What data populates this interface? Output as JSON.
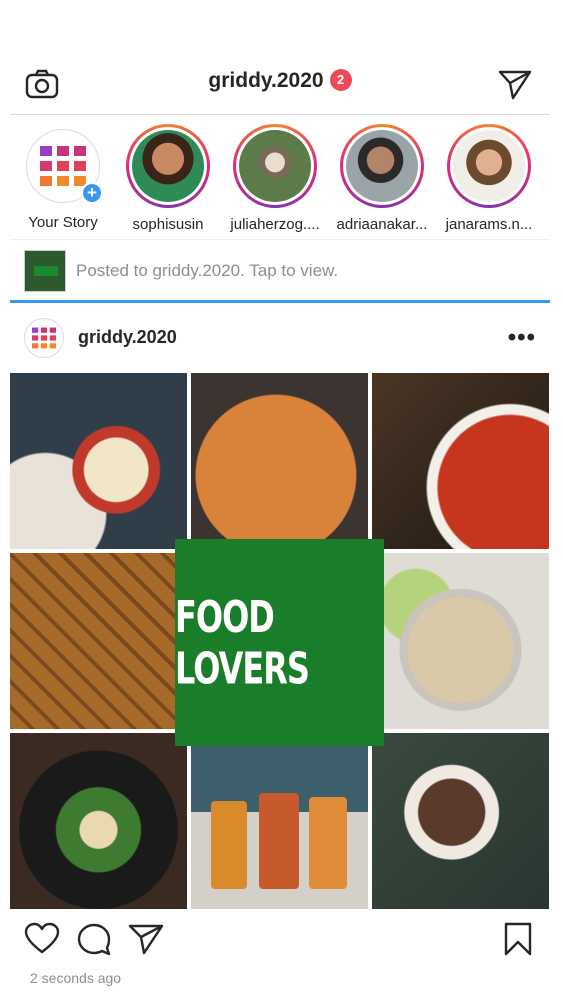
{
  "header": {
    "username": "griddy.2020",
    "notification_count": "2"
  },
  "stories": [
    {
      "label": "Your Story"
    },
    {
      "label": "sophisusin"
    },
    {
      "label": "juliaherzog...."
    },
    {
      "label": "adriaanakar..."
    },
    {
      "label": "janarams.n..."
    }
  ],
  "posted_bar": {
    "text": "Posted to griddy.2020. Tap to view."
  },
  "post": {
    "username": "griddy.2020",
    "overlay_title": "FOOD LOVERS",
    "timestamp": "2 seconds ago"
  },
  "icons": {
    "camera": "camera-icon",
    "direct": "paper-plane-icon",
    "like": "heart-icon",
    "comment": "comment-icon",
    "share": "paper-plane-icon",
    "save": "bookmark-icon"
  },
  "colors": {
    "accent": "#3897f0",
    "badge": "#ed4956",
    "overlay": "#1a7d2a"
  }
}
